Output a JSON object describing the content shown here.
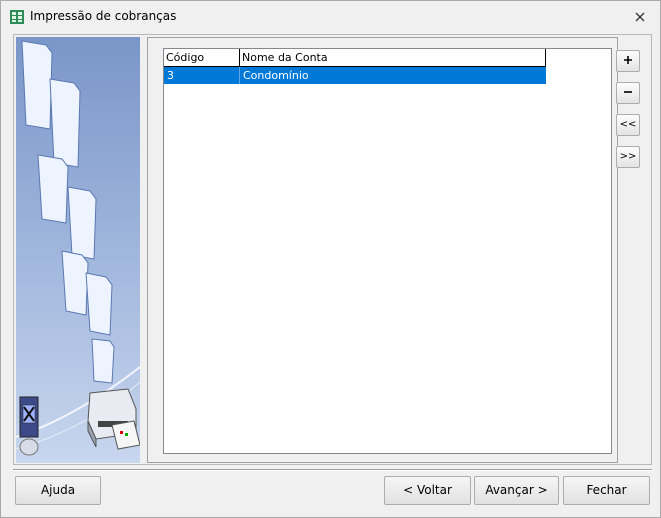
{
  "window": {
    "title": "Impressão de cobranças",
    "icon": "spreadsheet-icon",
    "close_icon": "close-icon"
  },
  "grid": {
    "columns": [
      "Código",
      "Nome da Conta"
    ],
    "rows": [
      {
        "codigo": "3",
        "nome": "Condomínio",
        "selected": true
      }
    ]
  },
  "side_buttons": {
    "add": "+",
    "remove": "−",
    "first": "<<",
    "last": ">>"
  },
  "footer": {
    "help": "Ajuda",
    "back": "< Voltar",
    "next": "Avançar >",
    "close": "Fechar"
  },
  "colors": {
    "selection": "#0078d7",
    "panel_gradient_top": "#7a96c9",
    "panel_gradient_bottom": "#c8d6ee"
  }
}
